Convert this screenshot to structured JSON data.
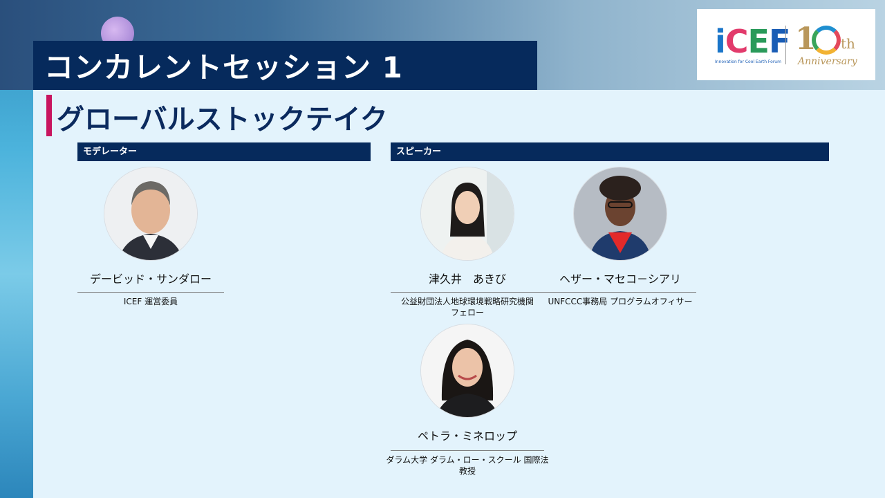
{
  "header": {
    "session_title": "コンカレントセッション 1",
    "subtitle": "グローバルストックテイク"
  },
  "logo": {
    "brand": [
      "i",
      "C",
      "E",
      "F"
    ],
    "tagline": "Innovation for Cool Earth Forum",
    "anniv_number": "1",
    "anniv_suffix": "th",
    "anniv_word": "Anniversary"
  },
  "sections": {
    "moderator_label": "モデレーター",
    "speaker_label": "スピーカー"
  },
  "moderator": {
    "name": "デービッド・サンダロー",
    "role": "ICEF 運営委員"
  },
  "speakers": [
    {
      "name": "津久井　あきび",
      "role_line1": "公益財団法人地球環境戦略研究機関",
      "role_line2": "フェロー"
    },
    {
      "name": "ヘザー・マセコ－シアリ",
      "role_line1": "UNFCCC事務局 プログラムオフィサー",
      "role_line2": ""
    },
    {
      "name": "ペトラ・ミネロップ",
      "role_line1": "ダラム大学 ダラム・ロー・スクール 国際法",
      "role_line2": "教授"
    }
  ],
  "colors": {
    "navy": "#062a5c",
    "accent": "#c8155f",
    "background": "#e3f3fc"
  }
}
